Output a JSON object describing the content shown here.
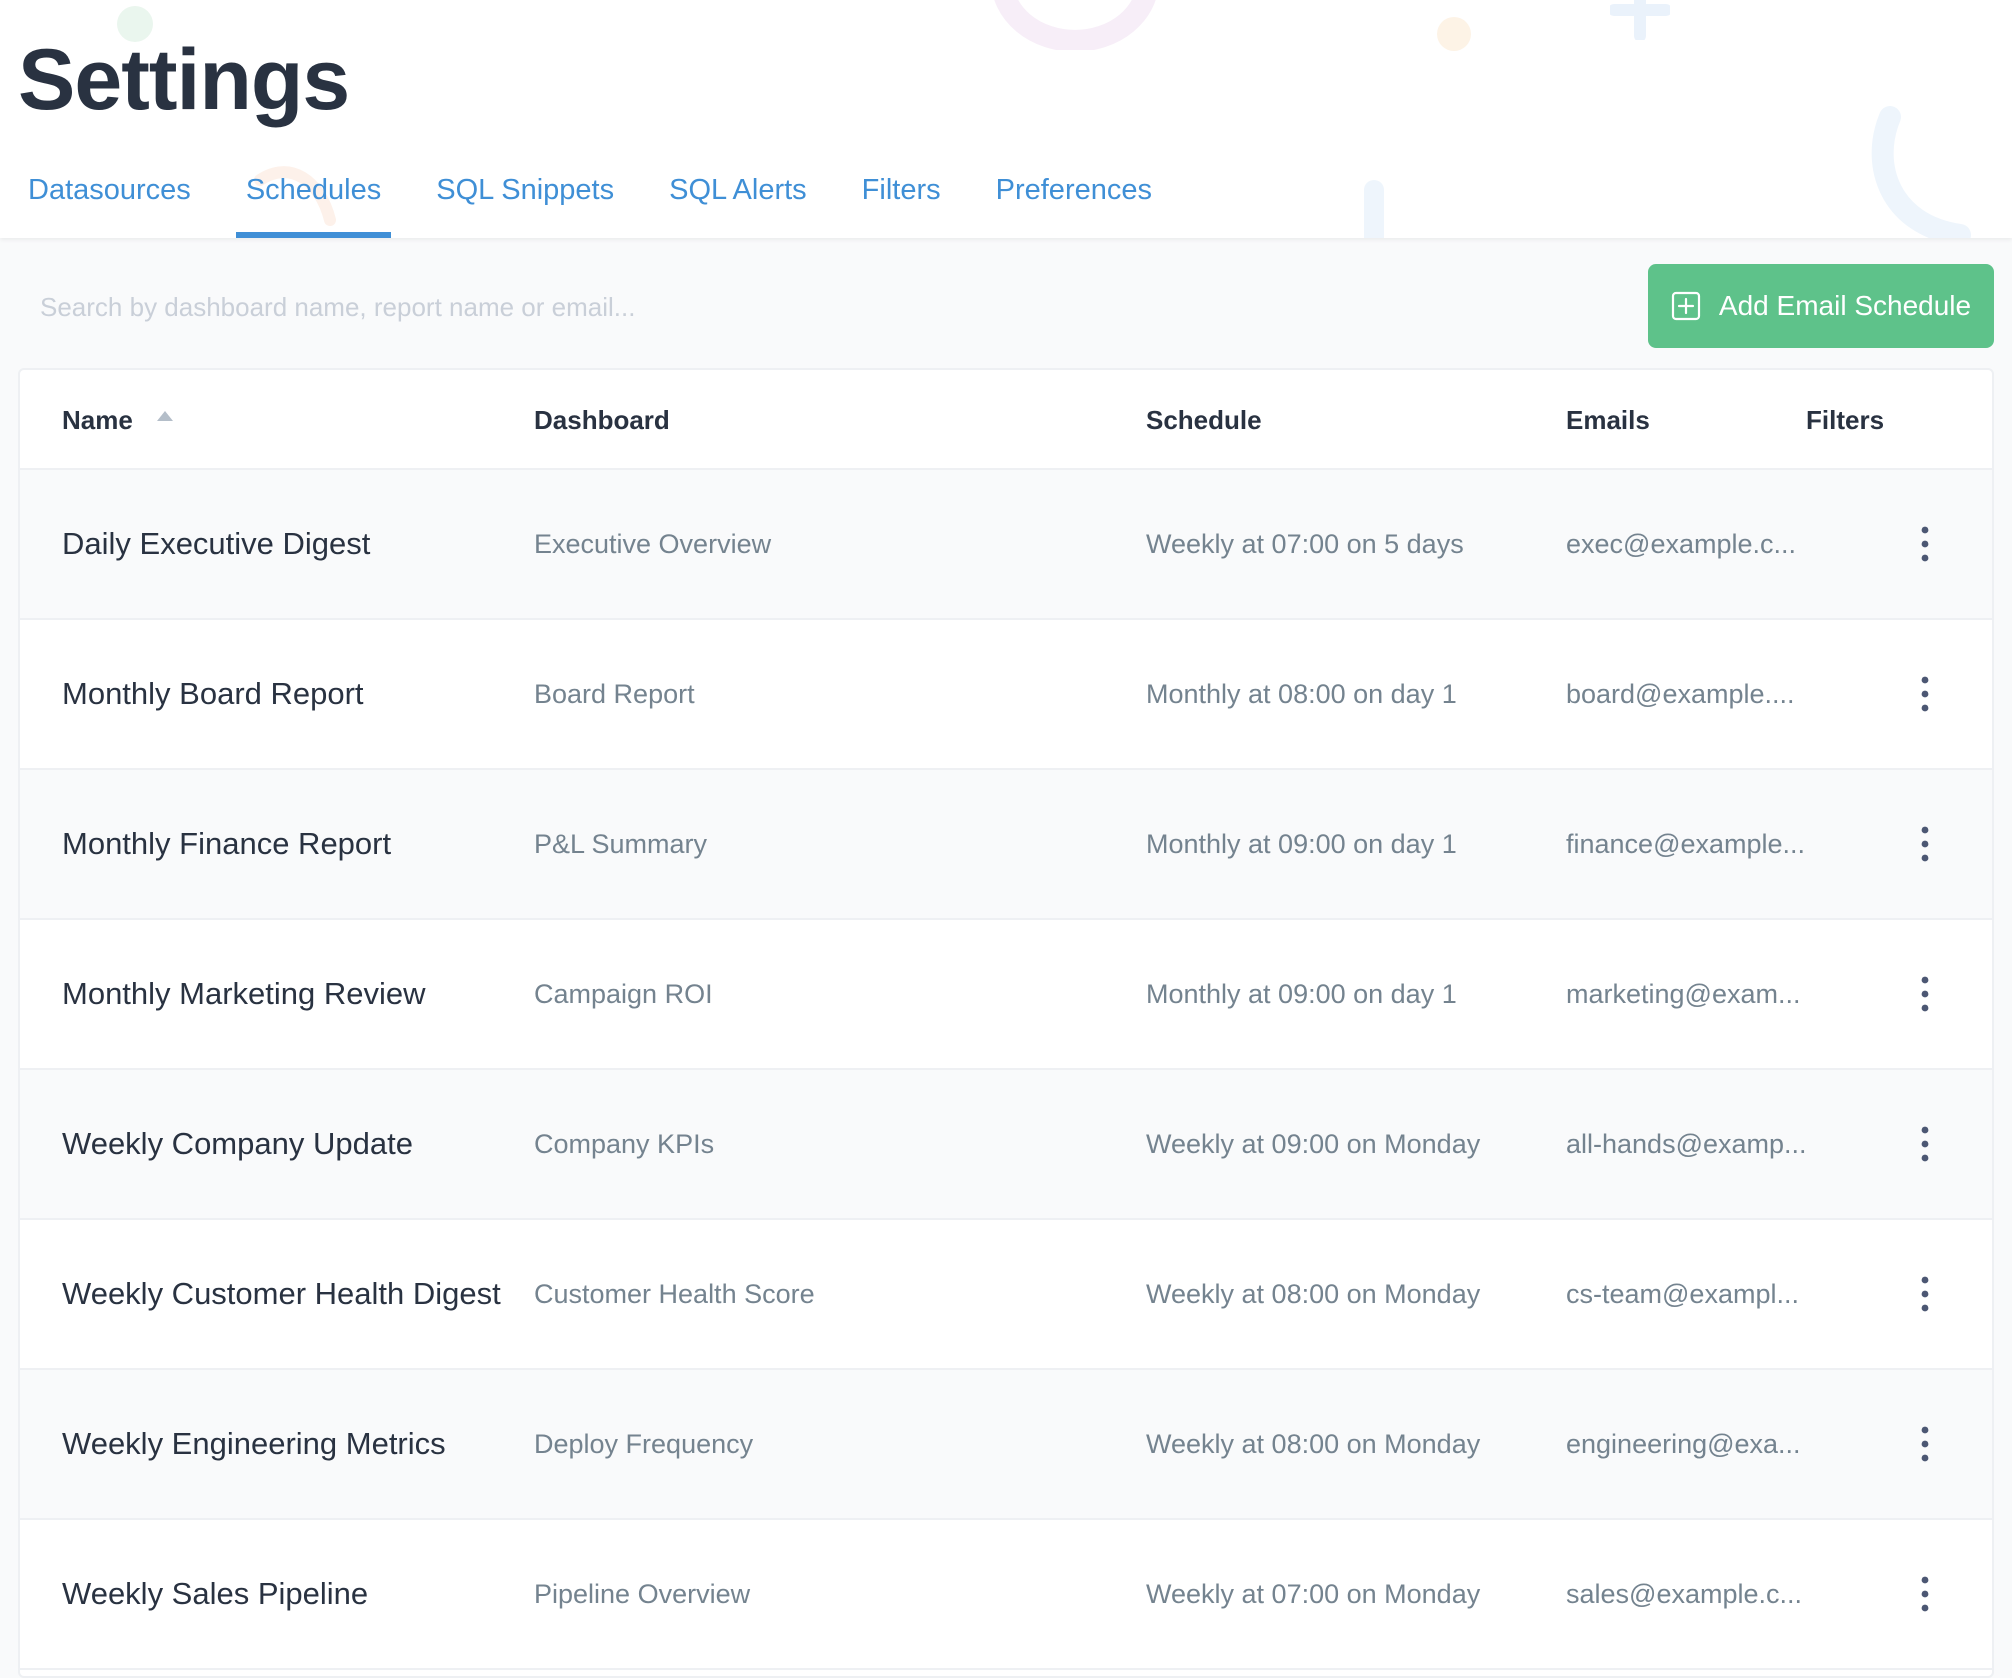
{
  "page": {
    "title": "Settings"
  },
  "tabs": [
    {
      "label": "Datasources",
      "active": false
    },
    {
      "label": "Schedules",
      "active": true
    },
    {
      "label": "SQL Snippets",
      "active": false
    },
    {
      "label": "SQL Alerts",
      "active": false
    },
    {
      "label": "Filters",
      "active": false
    },
    {
      "label": "Preferences",
      "active": false
    }
  ],
  "search": {
    "placeholder": "Search by dashboard name, report name or email...",
    "value": ""
  },
  "add_button": {
    "label": "Add Email Schedule",
    "icon": "plus-square-icon"
  },
  "table": {
    "columns": {
      "name": "Name",
      "dashboard": "Dashboard",
      "schedule": "Schedule",
      "emails": "Emails",
      "filters": "Filters"
    },
    "sort": {
      "column": "name",
      "direction": "ascending"
    },
    "rows": [
      {
        "name": "Daily Executive Digest",
        "dashboard": "Executive Overview",
        "schedule": "Weekly at 07:00 on 5 days",
        "emails": "exec@example.c...",
        "filters": ""
      },
      {
        "name": "Monthly Board Report",
        "dashboard": "Board Report",
        "schedule": "Monthly at 08:00 on day 1",
        "emails": "board@example....",
        "filters": ""
      },
      {
        "name": "Monthly Finance Report",
        "dashboard": "P&L Summary",
        "schedule": "Monthly at 09:00 on day 1",
        "emails": "finance@example...",
        "filters": ""
      },
      {
        "name": "Monthly Marketing Review",
        "dashboard": "Campaign ROI",
        "schedule": "Monthly at 09:00 on day 1",
        "emails": "marketing@exam...",
        "filters": ""
      },
      {
        "name": "Weekly Company Update",
        "dashboard": "Company KPIs",
        "schedule": "Weekly at 09:00 on Monday",
        "emails": "all-hands@examp...",
        "filters": ""
      },
      {
        "name": "Weekly Customer Health Digest",
        "dashboard": "Customer Health Score",
        "schedule": "Weekly at 08:00 on Monday",
        "emails": "cs-team@exampl...",
        "filters": ""
      },
      {
        "name": "Weekly Engineering Metrics",
        "dashboard": "Deploy Frequency",
        "schedule": "Weekly at 08:00 on Monday",
        "emails": "engineering@exa...",
        "filters": ""
      },
      {
        "name": "Weekly Sales Pipeline",
        "dashboard": "Pipeline Overview",
        "schedule": "Weekly at 07:00 on Monday",
        "emails": "sales@example.c...",
        "filters": ""
      }
    ]
  },
  "colors": {
    "accent": "#3f8fd6",
    "add_button_bg": "#5ec28a",
    "title_text": "#293241",
    "muted_text": "#74838f"
  }
}
